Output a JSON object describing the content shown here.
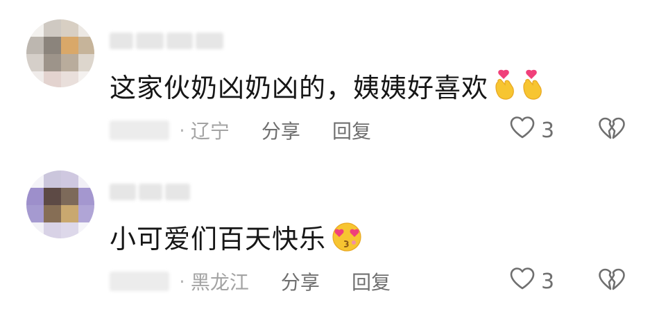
{
  "comments": [
    {
      "text": "这家伙奶凶奶凶的，姨姨好喜欢",
      "emojis": [
        "pinched-heart-hand-emoji",
        "pinched-heart-hand-emoji"
      ],
      "location": "辽宁",
      "share_label": "分享",
      "reply_label": "回复",
      "likes": "3",
      "dot": "·"
    },
    {
      "text": "小可爱们百天快乐",
      "emojis": [
        "heart-eyes-kiss-emoji"
      ],
      "location": "黑龙江",
      "share_label": "分享",
      "reply_label": "回复",
      "likes": "3",
      "dot": "·"
    }
  ],
  "icons": {
    "like": "heart-outline-icon",
    "dislike": "broken-heart-icon"
  },
  "colors": {
    "text": "#161616",
    "meta": "#8a8a8a",
    "action": "#6f6f6f",
    "emoji_yellow": "#f7c531",
    "emoji_pink": "#f0407a"
  }
}
